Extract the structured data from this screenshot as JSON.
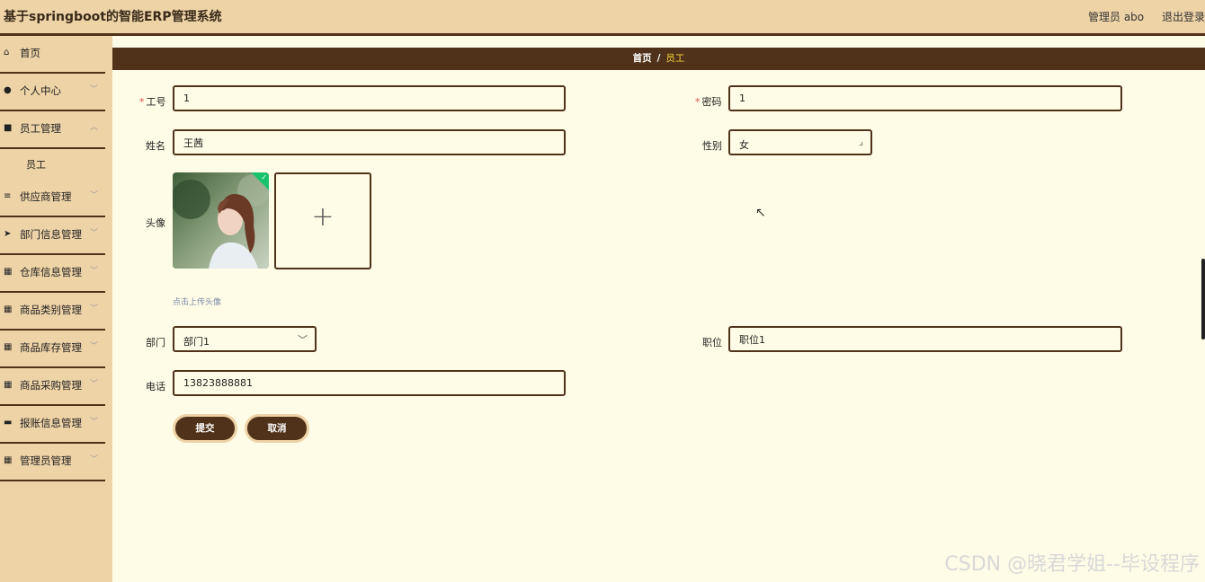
{
  "header": {
    "title": "基于springboot的智能ERP管理系统",
    "user": "管理员 abo",
    "logout": "退出登录"
  },
  "sidebar": {
    "items": [
      {
        "label": "首页",
        "icon": "home-icon"
      },
      {
        "label": "个人中心",
        "icon": "user-icon"
      },
      {
        "label": "员工管理",
        "icon": "chat-icon"
      },
      {
        "label": "供应商管理",
        "icon": "list-icon"
      },
      {
        "label": "部门信息管理",
        "icon": "send-icon"
      },
      {
        "label": "仓库信息管理",
        "icon": "grid-icon"
      },
      {
        "label": "商品类别管理",
        "icon": "grid-icon"
      },
      {
        "label": "商品库存管理",
        "icon": "grid-icon"
      },
      {
        "label": "商品采购管理",
        "icon": "grid-icon"
      },
      {
        "label": "报账信息管理",
        "icon": "monitor-icon"
      },
      {
        "label": "管理员管理",
        "icon": "grid-icon"
      }
    ],
    "subitem": "员工"
  },
  "breadcrumb": {
    "home": "首页",
    "separator": "/",
    "current": "员工"
  },
  "form": {
    "required_mark": "*",
    "employee_no": {
      "label": "工号",
      "value": "1"
    },
    "password": {
      "label": "密码",
      "value": "1"
    },
    "name": {
      "label": "姓名",
      "value": "王茜"
    },
    "gender": {
      "label": "性别",
      "value": "女"
    },
    "avatar": {
      "label": "头像",
      "plus": "+",
      "tip": "点击上传头像"
    },
    "department": {
      "label": "部门",
      "value": "部门1"
    },
    "position": {
      "label": "职位",
      "value": "职位1"
    },
    "phone": {
      "label": "电话",
      "value": "13823888881"
    },
    "submit": "提交",
    "cancel": "取消"
  },
  "watermark": "CSDN @晓君学姐--毕设程序",
  "colors": {
    "header_bg": "#eed3a7",
    "dark_brown": "#4f3219",
    "content_bg": "#fefce6",
    "breadcrumb_active": "#f5d23b",
    "success_badge": "#17c26b"
  }
}
